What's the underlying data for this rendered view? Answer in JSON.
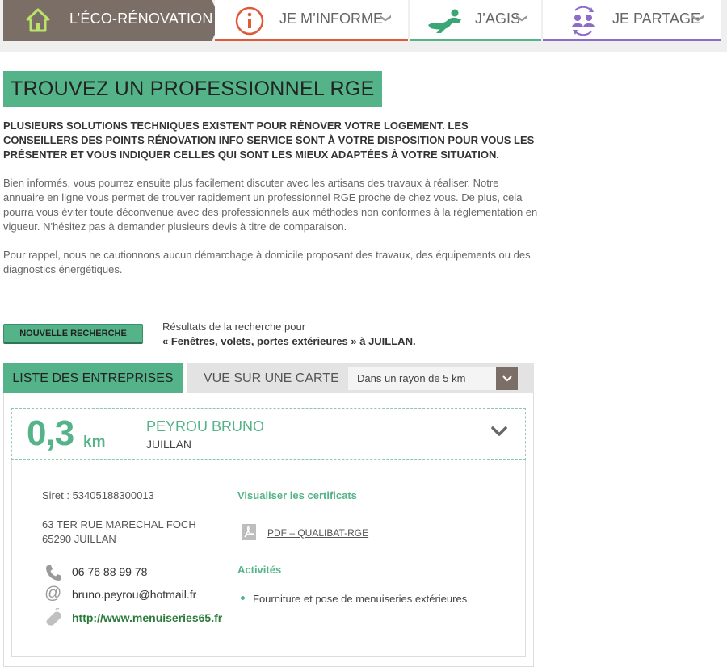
{
  "nav": {
    "home": "L’ÉCO-RÉNOVATION",
    "items": [
      {
        "label": "JE M’INFORME",
        "color": "#e05a3a",
        "icon": "info-icon"
      },
      {
        "label": "J’AGIS",
        "color": "#54b389",
        "icon": "action-icon"
      },
      {
        "label": "JE PARTAGE",
        "color": "#8d6bc8",
        "icon": "share-people-icon"
      }
    ]
  },
  "page": {
    "title": "TROUVEZ UN PROFESSIONNEL RGE",
    "lead": "PLUSIEURS SOLUTIONS TECHNIQUES EXISTENT POUR RÉNOVER VOTRE LOGEMENT. LES CONSEILLERS DES POINTS RÉNOVATION INFO SERVICE SONT À VOTRE DISPOSITION POUR VOUS LES PRÉSENTER ET VOUS INDIQUER CELLES QUI SONT LES MIEUX ADAPTÉES À VOTRE SITUATION.",
    "para1": "Bien informés, vous pourrez ensuite plus facilement discuter avec les artisans des travaux à réaliser. Notre annuaire en ligne vous permet de trouver rapidement un professionnel RGE proche de chez vous. De plus, cela pourra vous éviter toute déconvenue avec des professionnels aux méthodes non conformes à la réglementation en vigueur. N'hésitez pas à demander plusieurs devis à titre de comparaison.",
    "para2": "Pour rappel, nous ne cautionnons aucun démarchage à domicile proposant des travaux, des équipements ou des diagnostics énergétiques."
  },
  "search": {
    "new_search": "NOUVELLE RECHERCHE",
    "results_label": "Résultats de la recherche pour",
    "results_query": "« Fenêtres, volets, portes extérieures » à JUILLAN."
  },
  "tabs": {
    "list": "LISTE DES ENTREPRISES",
    "map": "VUE SUR UNE CARTE",
    "radius": "Dans un rayon de 5 km"
  },
  "result": {
    "distance": "0,3",
    "unit": "km",
    "name": "PEYROU BRUNO",
    "city": "JUILLAN",
    "siret": "Siret : 53405188300013",
    "address_line1": "63 TER RUE MARECHAL FOCH",
    "address_line2": "65290 JUILLAN",
    "phone": "06 76 88 99 78",
    "email": "bruno.peyrou@hotmail.fr",
    "website": "http://www.menuiseries65.fr",
    "certificates_heading": "Visualiser les certificats",
    "certificate": "PDF – QUALIBAT-RGE",
    "activities_heading": "Activités",
    "activity": "Fourniture et pose de menuiseries extérieures"
  },
  "colors": {
    "accent": "#54b389",
    "home_bg": "#7a6e66"
  }
}
